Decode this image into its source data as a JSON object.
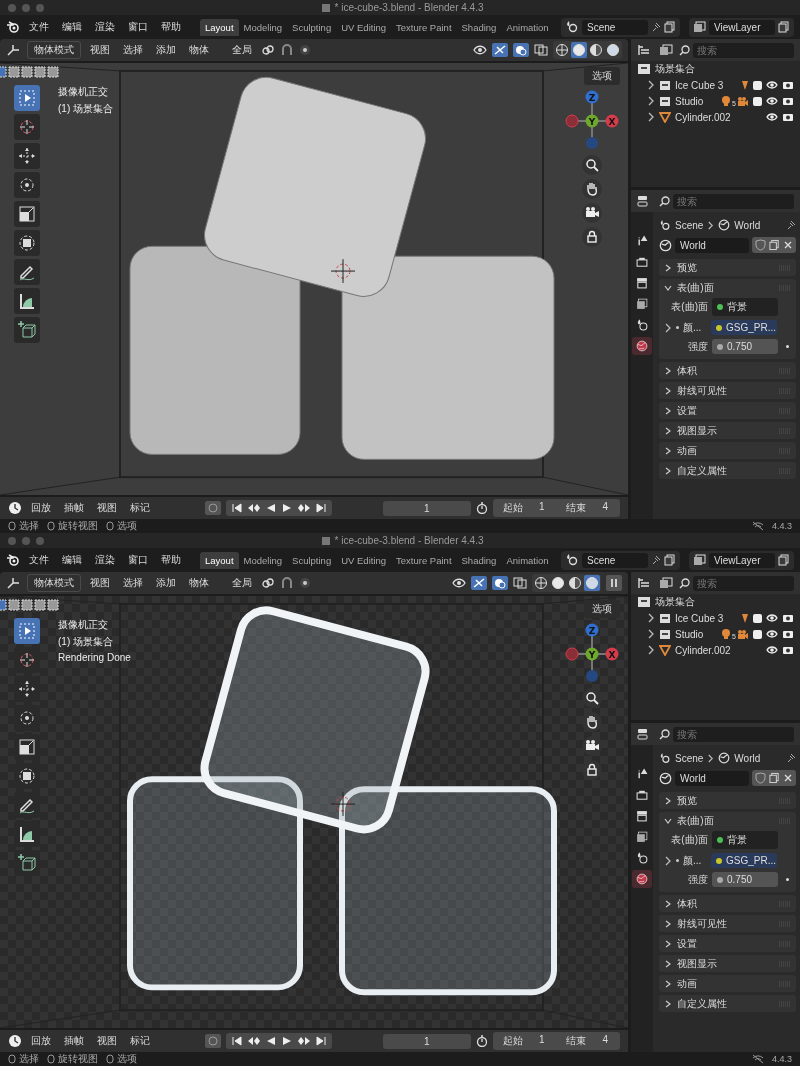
{
  "windows": [
    {
      "title": "* ice-cube-3.blend - Blender 4.4.3",
      "menus": [
        "文件",
        "编辑",
        "渲染",
        "窗口",
        "帮助"
      ],
      "workspaces": [
        {
          "label": "Layout",
          "selected": true
        },
        {
          "label": "Modeling",
          "selected": false
        },
        {
          "label": "Sculpting",
          "selected": false
        },
        {
          "label": "UV Editing",
          "selected": false
        },
        {
          "label": "Texture Paint",
          "selected": false
        },
        {
          "label": "Shading",
          "selected": false
        },
        {
          "label": "Animation",
          "selected": false
        }
      ],
      "scene": "Scene",
      "view_layer": "ViewLayer",
      "header": {
        "mode": "物体模式",
        "menus": [
          "视图",
          "选择",
          "添加",
          "物体"
        ],
        "orientation": "全局",
        "render_pause": false,
        "shading": [
          {
            "kind": "wireframe",
            "selected": false
          },
          {
            "kind": "solid",
            "selected": true
          },
          {
            "kind": "material",
            "selected": false
          },
          {
            "kind": "rendered",
            "selected": false
          }
        ]
      },
      "viewport": {
        "kind": "solid",
        "options": "选项",
        "overlay": [
          "摄像机正交",
          "(1) 场景集合"
        ],
        "tools": [
          {
            "kind": "select",
            "selected": true
          },
          {
            "kind": "cursor",
            "selected": false
          },
          {
            "kind": "move",
            "selected": false
          },
          {
            "kind": "rotate",
            "selected": false
          },
          {
            "kind": "scale",
            "selected": false
          },
          {
            "kind": "transform",
            "selected": false
          },
          {
            "kind": "annotate",
            "selected": false
          },
          {
            "kind": "measure",
            "selected": false
          },
          {
            "kind": "add-cube",
            "selected": false
          }
        ],
        "axes": [
          {
            "label": "Z",
            "color": "#2f6fd0"
          },
          {
            "label": "Y",
            "color": "#6ea92c"
          },
          {
            "label": "X",
            "color": "#d53c4b"
          }
        ]
      },
      "outliner": {
        "search_placeholder": "搜索",
        "root": "场景集合",
        "items": [
          {
            "label": "Ice Cube 3",
            "kind": "collection",
            "checked": true
          },
          {
            "label": "Studio",
            "kind": "collection",
            "checked": true,
            "badge": "5"
          },
          {
            "label": "Cylinder.002",
            "kind": "mesh"
          }
        ]
      },
      "properties": {
        "search_placeholder": "搜索",
        "breadcrumb": [
          "Scene",
          "World"
        ],
        "world": "World",
        "tabs": [
          {
            "kind": "tool",
            "selected": false
          },
          {
            "kind": "render",
            "selected": false
          },
          {
            "kind": "output",
            "selected": false
          },
          {
            "kind": "view-layer",
            "selected": false
          },
          {
            "kind": "scene",
            "selected": false
          },
          {
            "kind": "world",
            "selected": true
          }
        ],
        "panels": [
          {
            "label": "预览",
            "expanded": false
          },
          {
            "label": "表(曲)面",
            "expanded": true,
            "fields": [
              {
                "kind": "shader",
                "label": "表(曲)面",
                "value": "背景",
                "color": "#4cbf55"
              },
              {
                "kind": "color",
                "label": "颜...",
                "value": "GSG_PR...",
                "color": "#c9c42a"
              },
              {
                "kind": "number",
                "label": "强度",
                "value": "0.750"
              }
            ]
          },
          {
            "label": "体积",
            "expanded": false
          },
          {
            "label": "射线可见性",
            "expanded": false
          },
          {
            "label": "设置",
            "expanded": false
          },
          {
            "label": "视图显示",
            "expanded": false
          },
          {
            "label": "动画",
            "expanded": false
          },
          {
            "label": "自定义属性",
            "expanded": false
          }
        ]
      },
      "timeline": {
        "menus": [
          "回放",
          "插帧",
          "视图",
          "标记"
        ],
        "current_frame": "1",
        "start_label": "起始",
        "start": "1",
        "end_label": "结束",
        "end": "4"
      },
      "status": {
        "items": [
          "选择",
          "旋转视图",
          "选项"
        ],
        "version": "4.4.3"
      }
    },
    {
      "title": "* ice-cube-3.blend - Blender 4.4.3",
      "menus": [
        "文件",
        "编辑",
        "渲染",
        "窗口",
        "帮助"
      ],
      "workspaces": [
        {
          "label": "Layout",
          "selected": true
        },
        {
          "label": "Modeling",
          "selected": false
        },
        {
          "label": "Sculpting",
          "selected": false
        },
        {
          "label": "UV Editing",
          "selected": false
        },
        {
          "label": "Texture Paint",
          "selected": false
        },
        {
          "label": "Shading",
          "selected": false
        },
        {
          "label": "Animation",
          "selected": false
        }
      ],
      "scene": "Scene",
      "view_layer": "ViewLayer",
      "header": {
        "mode": "物体模式",
        "menus": [
          "视图",
          "选择",
          "添加",
          "物体"
        ],
        "orientation": "全局",
        "render_pause": true,
        "shading": [
          {
            "kind": "wireframe",
            "selected": false
          },
          {
            "kind": "solid",
            "selected": false
          },
          {
            "kind": "material",
            "selected": false
          },
          {
            "kind": "rendered",
            "selected": true
          }
        ]
      },
      "viewport": {
        "kind": "rendered",
        "options": "选项",
        "overlay": [
          "摄像机正交",
          "(1) 场景集合",
          "Rendering Done"
        ],
        "tools": [
          {
            "kind": "select",
            "selected": true
          },
          {
            "kind": "cursor",
            "selected": false
          },
          {
            "kind": "move",
            "selected": false
          },
          {
            "kind": "rotate",
            "selected": false
          },
          {
            "kind": "scale",
            "selected": false
          },
          {
            "kind": "transform",
            "selected": false
          },
          {
            "kind": "annotate",
            "selected": false
          },
          {
            "kind": "measure",
            "selected": false
          },
          {
            "kind": "add-cube",
            "selected": false
          }
        ],
        "axes": [
          {
            "label": "Z",
            "color": "#2f6fd0"
          },
          {
            "label": "Y",
            "color": "#6ea92c"
          },
          {
            "label": "X",
            "color": "#d53c4b"
          }
        ]
      },
      "outliner": {
        "search_placeholder": "搜索",
        "root": "场景集合",
        "items": [
          {
            "label": "Ice Cube 3",
            "kind": "collection",
            "checked": true
          },
          {
            "label": "Studio",
            "kind": "collection",
            "checked": true,
            "badge": "5"
          },
          {
            "label": "Cylinder.002",
            "kind": "mesh"
          }
        ]
      },
      "properties": {
        "search_placeholder": "搜索",
        "breadcrumb": [
          "Scene",
          "World"
        ],
        "world": "World",
        "tabs": [
          {
            "kind": "tool",
            "selected": false
          },
          {
            "kind": "render",
            "selected": false
          },
          {
            "kind": "output",
            "selected": false
          },
          {
            "kind": "view-layer",
            "selected": false
          },
          {
            "kind": "scene",
            "selected": false
          },
          {
            "kind": "world",
            "selected": true
          }
        ],
        "panels": [
          {
            "label": "预览",
            "expanded": false
          },
          {
            "label": "表(曲)面",
            "expanded": true,
            "fields": [
              {
                "kind": "shader",
                "label": "表(曲)面",
                "value": "背景",
                "color": "#4cbf55"
              },
              {
                "kind": "color",
                "label": "颜...",
                "value": "GSG_PR...",
                "color": "#c9c42a"
              },
              {
                "kind": "number",
                "label": "强度",
                "value": "0.750"
              }
            ]
          },
          {
            "label": "体积",
            "expanded": false
          },
          {
            "label": "射线可见性",
            "expanded": false
          },
          {
            "label": "设置",
            "expanded": false
          },
          {
            "label": "视图显示",
            "expanded": false
          },
          {
            "label": "动画",
            "expanded": false
          },
          {
            "label": "自定义属性",
            "expanded": false
          }
        ]
      },
      "timeline": {
        "menus": [
          "回放",
          "插帧",
          "视图",
          "标记"
        ],
        "current_frame": "1",
        "start_label": "起始",
        "start": "1",
        "end_label": "结束",
        "end": "4"
      },
      "status": {
        "items": [
          "选择",
          "旋转视图",
          "选项"
        ],
        "version": "4.4.3"
      }
    }
  ]
}
